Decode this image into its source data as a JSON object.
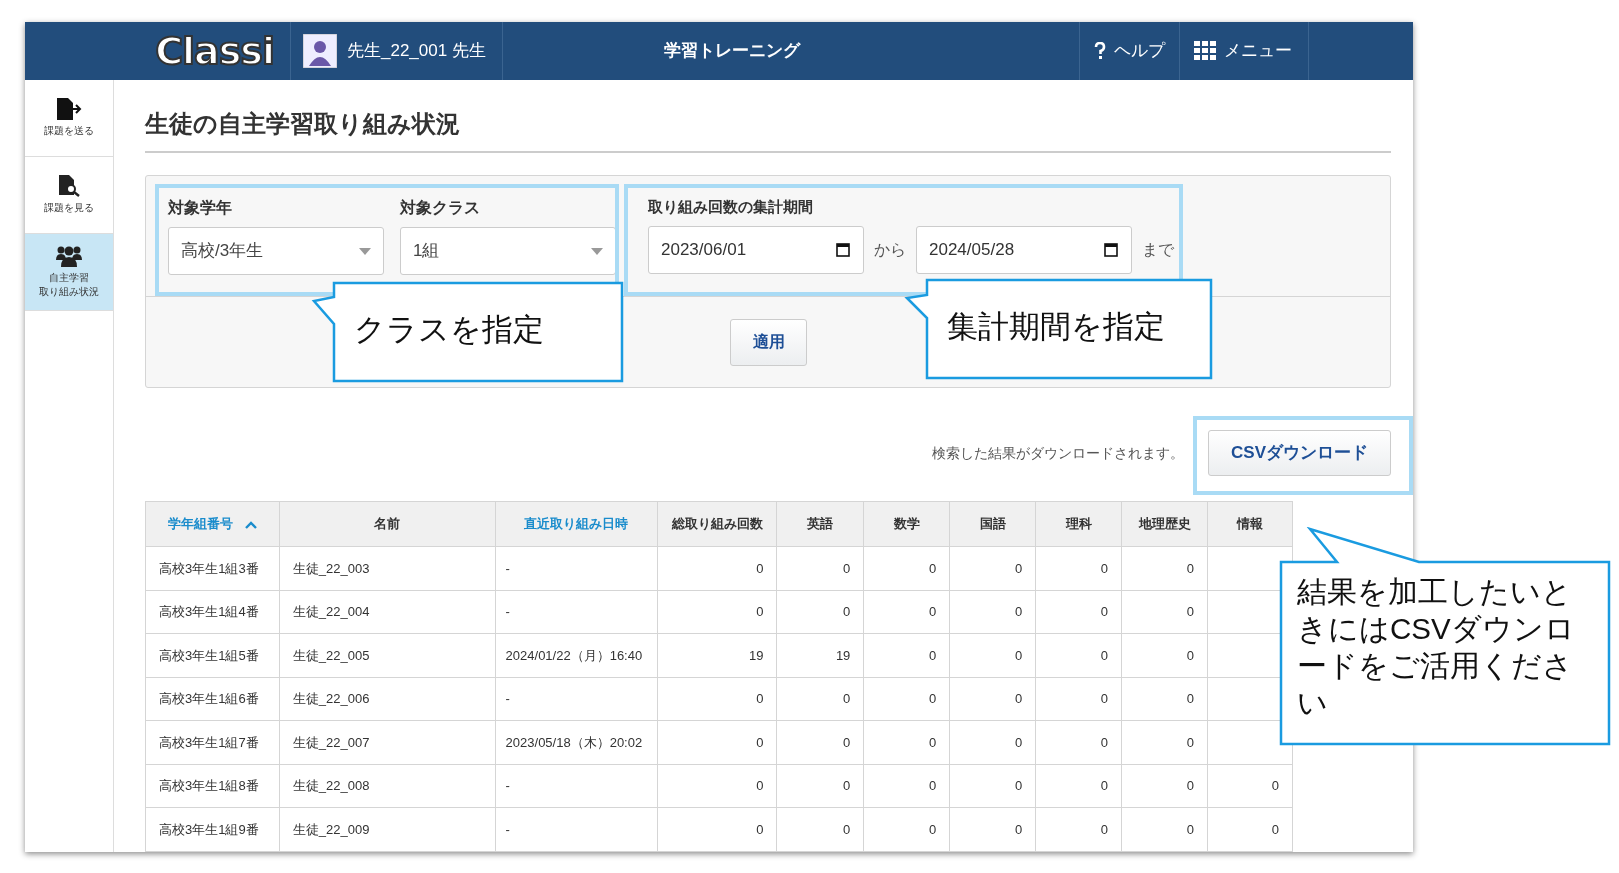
{
  "header": {
    "logo": "Classi",
    "user": "先生_22_001 先生",
    "title": "学習トレーニング",
    "links": [
      {
        "kind": "help",
        "label": "ヘルプ"
      },
      {
        "kind": "menu",
        "label": "メニュー"
      }
    ]
  },
  "sidebar": {
    "items": [
      {
        "kind": "send",
        "lines": [
          "課題を送る"
        ],
        "selected": false
      },
      {
        "kind": "view",
        "lines": [
          "課題を見る"
        ],
        "selected": false
      },
      {
        "kind": "group",
        "lines": [
          "自主学習",
          "取り組み状況"
        ],
        "selected": true
      }
    ]
  },
  "page_title": "生徒の自主学習取り組み状況",
  "filters": {
    "grade": {
      "label": "対象学年",
      "value": "高校/3年生"
    },
    "class": {
      "label": "対象クラス",
      "value": "1組"
    },
    "period": {
      "label": "取り組み回数の集計期間",
      "from": "2023/06/01",
      "from_suffix": "から",
      "to": "2024/05/28",
      "to_suffix": "まで"
    },
    "apply_button": "適用"
  },
  "download": {
    "note": "検索した結果がダウンロードされます。",
    "button": "CSVダウンロード"
  },
  "table": {
    "columns": [
      {
        "label": "学年組番号",
        "sortable": true,
        "sorted": true
      },
      {
        "label": "名前",
        "sortable": false,
        "sorted": false
      },
      {
        "label": "直近取り組み日時",
        "sortable": true,
        "sorted": false
      },
      {
        "label": "総取り組み回数",
        "sortable": false,
        "sorted": false
      },
      {
        "label": "英語",
        "sortable": false,
        "sorted": false
      },
      {
        "label": "数学",
        "sortable": false,
        "sorted": false
      },
      {
        "label": "国語",
        "sortable": false,
        "sorted": false
      },
      {
        "label": "理科",
        "sortable": false,
        "sorted": false
      },
      {
        "label": "地理歴史",
        "sortable": false,
        "sorted": false
      },
      {
        "label": "情報",
        "sortable": false,
        "sorted": false
      }
    ],
    "rows": [
      {
        "cells": [
          "高校3年生1組3番",
          "生徒_22_003",
          "-",
          "0",
          "0",
          "0",
          "0",
          "0",
          "0"
        ]
      },
      {
        "cells": [
          "高校3年生1組4番",
          "生徒_22_004",
          "-",
          "0",
          "0",
          "0",
          "0",
          "0",
          "0"
        ]
      },
      {
        "cells": [
          "高校3年生1組5番",
          "生徒_22_005",
          "2024/01/22（月）16:40",
          "19",
          "19",
          "0",
          "0",
          "0",
          "0"
        ]
      },
      {
        "cells": [
          "高校3年生1組6番",
          "生徒_22_006",
          "-",
          "0",
          "0",
          "0",
          "0",
          "0",
          "0"
        ]
      },
      {
        "cells": [
          "高校3年生1組7番",
          "生徒_22_007",
          "2023/05/18（木）20:02",
          "0",
          "0",
          "0",
          "0",
          "0",
          "0"
        ]
      },
      {
        "cells": [
          "高校3年生1組8番",
          "生徒_22_008",
          "-",
          "0",
          "0",
          "0",
          "0",
          "0",
          "0",
          "0"
        ]
      },
      {
        "cells": [
          "高校3年生1組9番",
          "生徒_22_009",
          "-",
          "0",
          "0",
          "0",
          "0",
          "0",
          "0",
          "0"
        ]
      }
    ]
  },
  "callouts": [
    "クラスを指定",
    "集計期間を指定",
    "結果を加工したいときにはCSVダウンロードをご活用ください"
  ]
}
